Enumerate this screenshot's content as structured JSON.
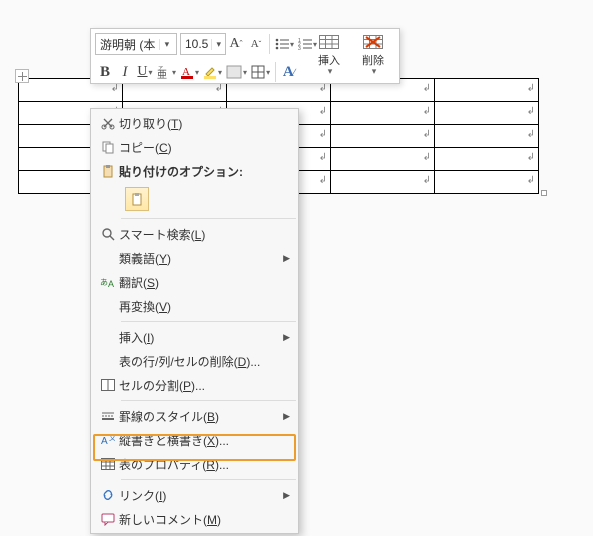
{
  "toolbar": {
    "font_name": "游明朝 (本",
    "font_size": "10.5",
    "bold": "B",
    "italic": "I",
    "grow_font": "A",
    "shrink_font": "A",
    "styles_char": "A",
    "insert_label": "挿入",
    "delete_label": "削除"
  },
  "table": {
    "rows": 5,
    "cols": 5
  },
  "context_menu": {
    "cut": "切り取り(T)",
    "copy": "コピー(C)",
    "paste_options_header": "貼り付けのオプション:",
    "smart_lookup": "スマート検索(L)",
    "synonyms": "類義語(Y)",
    "translate": "翻訳(S)",
    "reconvert": "再変換(V)",
    "insert": "挿入(I)",
    "delete_rows": "表の行/列/セルの削除(D)...",
    "split_cells": "セルの分割(P)...",
    "border_style": "罫線のスタイル(B)",
    "text_direction": "縦書きと横書き(X)...",
    "table_properties": "表のプロパティ(R)...",
    "link": "リンク(I)",
    "new_comment": "新しいコメント(M)"
  },
  "colors": {
    "highlight_border": "#ec9d2d",
    "red": "#d83b01",
    "blue": "#3b6db3"
  }
}
